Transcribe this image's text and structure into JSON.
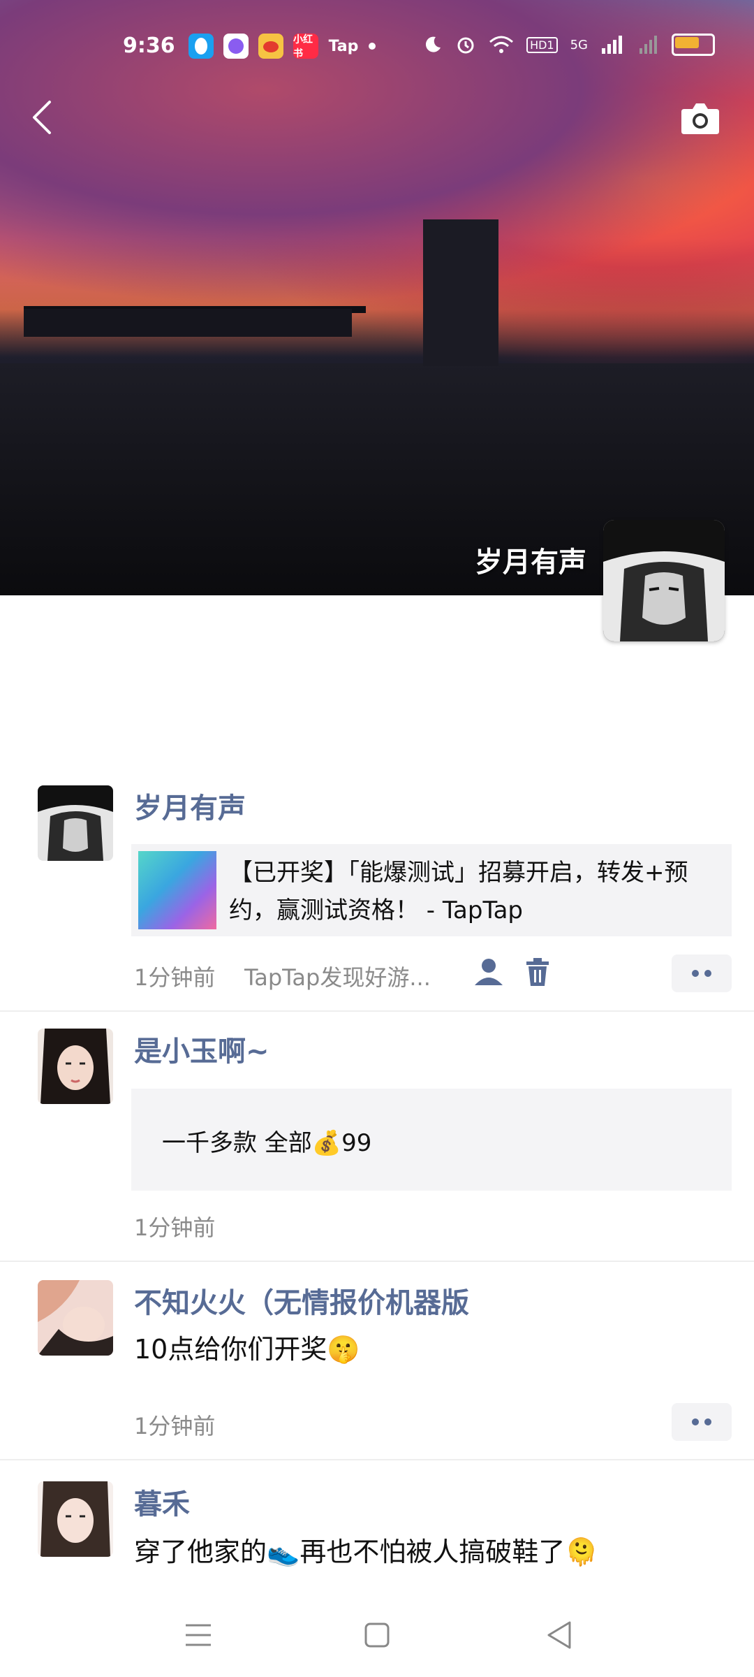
{
  "status_bar": {
    "time": "9:36",
    "apps": [
      "QQ",
      "Soul",
      "微博",
      "小红书",
      "Tap"
    ],
    "network": "5G",
    "hd": "HD1"
  },
  "header": {
    "profile_name": "岁月有声"
  },
  "posts": [
    {
      "name": "岁月有声",
      "share_text": "【已开奖】「能爆测试」招募开启，转发+预约，赢测试资格！ - TapTap",
      "time": "1分钟前",
      "source": "TapTap发现好游..."
    },
    {
      "name": "是小玉啊~",
      "quote": "一千多款 全部💰99",
      "time": "1分钟前"
    },
    {
      "name": "不知火火（无情报价机器版",
      "text": "10点给你们开奖🤫",
      "time": "1分钟前"
    },
    {
      "name": "暮禾",
      "text": "穿了他家的👟再也不怕被人搞破鞋了🫠"
    }
  ],
  "colors": {
    "link_name": "#576b95",
    "meta": "#8a8a8a"
  }
}
